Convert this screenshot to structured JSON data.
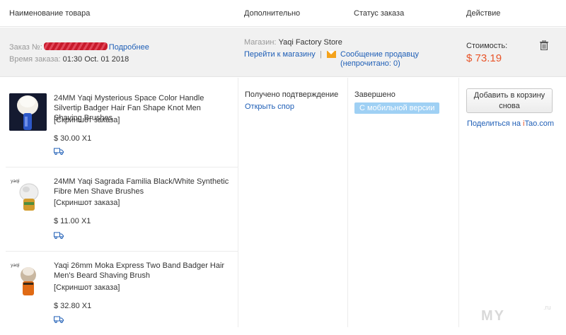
{
  "header": {
    "col_name": "Наименование товара",
    "col_extra": "Дополнительно",
    "col_status": "Статус заказа",
    "col_action": "Действие"
  },
  "order": {
    "number_label": "Заказ №:",
    "details_link": "Подробнее",
    "time_label": "Время заказа:",
    "time_value": "01:30 Oct. 01 2018",
    "store_label": "Магазин:",
    "store_name": "Yaqi Factory Store",
    "go_to_store": "Перейти к магазину",
    "separator": "|",
    "message_seller": "Сообщение продавцу",
    "unread": "(непрочитано: 0)",
    "cost_label": "Стоимость:",
    "cost_value": "$ 73.19"
  },
  "products": [
    {
      "title": "24MM Yaqi Mysterious Space Color Handle Silvertip Badger Hair Fan Shape Knot Men Shaving Brushes",
      "snapshot": "[Скриншот заказа]",
      "price": "$ 30.00 X1"
    },
    {
      "title": "24MM Yaqi Sagrada Familia Black/White Synthetic Fibre Men Shave Brushes",
      "snapshot": "[Скриншот заказа]",
      "price": "$ 11.00 X1"
    },
    {
      "title": "Yaqi 26mm Moka Express Two Band Badger Hair Men's Beard Shaving Brush",
      "snapshot": "[Скриншот заказа]",
      "price": "$ 32.80 X1"
    }
  ],
  "extra": {
    "received": "Получено подтверждение",
    "open_dispute": "Открыть спор"
  },
  "status": {
    "value": "Завершено",
    "mobile_badge": "С мобильной версии"
  },
  "actions": {
    "add_to_cart_line1": "Добавить в корзину",
    "add_to_cart_line2": "снова",
    "share_prefix": "Поделиться на ",
    "share_i": "i",
    "share_rest": "Tao.com"
  },
  "watermark": {
    "text": "MY",
    "suffix": ".ru"
  },
  "colors": {
    "link": "#1e5eb6",
    "price": "#e8552a",
    "badge": "#9fd0f4",
    "order_bg": "#f1f1f1"
  }
}
